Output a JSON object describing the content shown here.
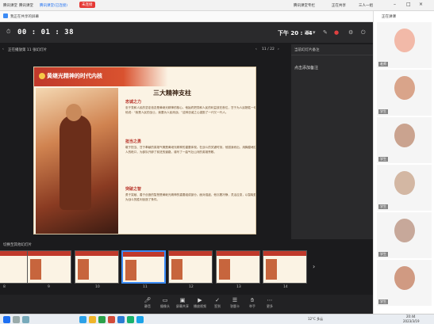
{
  "topbar": {
    "app_name": "腾讯课堂",
    "tab1": "腾讯课堂",
    "tab2": "腾讯课堂(已连接)",
    "badge": "未连接",
    "right1": "腾讯课堂专栏",
    "right2": "正在共享",
    "right3": "三人一组"
  },
  "secbar": {
    "title": "我正在共享的屏幕"
  },
  "timer": {
    "elapsed": "00 : 01 : 38",
    "clock": "下午 20 : 44"
  },
  "presenter": {
    "title": "正在播放第 11 张幻灯片",
    "page": "11 / 22"
  },
  "notes": {
    "header": "当前幻灯片备注",
    "body": "点击添加备注"
  },
  "slide": {
    "header_title": "黄继光精神的时代内核",
    "main_title": "三大精神支柱",
    "sec1": "忠诚之力",
    "para1": "忠于党和人民的坚定信念是黄继光精神的核心。他始终把党和人民的利益放在首位，甘于为人民牺牲一切。他说：“我是人民的战士，我要为人民而战。”这种忠诚之心激励了一代又一代人。",
    "sec2": "担当之勇",
    "para2": "敢于担当、甘于奉献的英雄气概是黄继光精神的重要体现。在战斗的关键时刻，他挺身而出，用胸膛堵住敌人的枪口，为部队开辟了前进的道路，谱写了一曲气壮山河的英雄赞歌。",
    "sec3": "突破之智",
    "para3": "勇于突破、善于创造的智慧是黄继光精神的重要组成部分。面对强敌，他沉着冷静，灵活应变，以智取胜，为战斗的胜利创造了条件。"
  },
  "thumbnails": [
    {
      "num": "8"
    },
    {
      "num": "9"
    },
    {
      "num": "10"
    },
    {
      "num": "11"
    },
    {
      "num": "12"
    },
    {
      "num": "13"
    },
    {
      "num": "14"
    }
  ],
  "thumbs_header": "切换至其他幻灯片",
  "toolbar": [
    {
      "label": "静音",
      "icon": "mic-icon"
    },
    {
      "label": "摄像头",
      "icon": "camera-icon"
    },
    {
      "label": "屏幕共享",
      "icon": "screen-icon"
    },
    {
      "label": "播放视频",
      "icon": "video-icon"
    },
    {
      "label": "签到",
      "icon": "checkin-icon"
    },
    {
      "label": "答题卡",
      "icon": "quiz-icon"
    },
    {
      "label": "举手",
      "icon": "hand-icon"
    },
    {
      "label": "更多",
      "icon": "more-icon"
    }
  ],
  "video": {
    "title": "正在讲课",
    "tiles": [
      {
        "name": "老师"
      },
      {
        "name": "学生"
      },
      {
        "name": "学生"
      },
      {
        "name": "学生"
      },
      {
        "name": "学生"
      },
      {
        "name": "学生"
      }
    ]
  },
  "taskbar": {
    "weather": "12°C 多云",
    "time": "20:44",
    "date": "2023/3/19"
  },
  "colors": {
    "accent": "#3c8bf5",
    "slide_red": "#c0392b",
    "record": "#e04040"
  }
}
